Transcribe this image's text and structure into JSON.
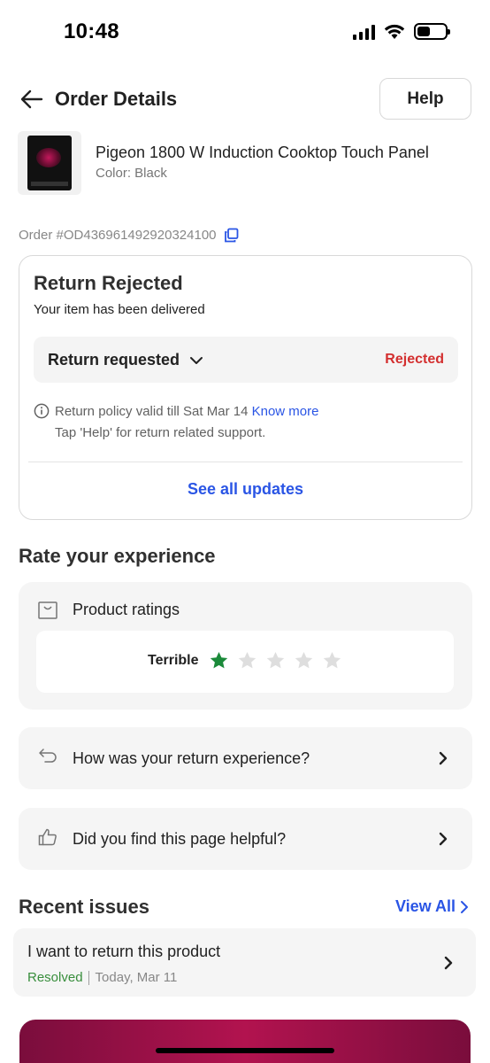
{
  "status_bar": {
    "time": "10:48"
  },
  "header": {
    "title": "Order Details",
    "help_label": "Help"
  },
  "product": {
    "name": "Pigeon 1800 W Induction Cooktop Touch Panel",
    "color": "Color: Black"
  },
  "order": {
    "id": "Order #OD436961492920324100"
  },
  "status_card": {
    "title": "Return Rejected",
    "subtitle": "Your item has been delivered",
    "return_label": "Return requested",
    "return_status": "Rejected",
    "policy_text": "Return policy valid till Sat Mar 14",
    "know_more": "Know more",
    "help_note": "Tap 'Help' for return related support.",
    "see_updates": "See all updates"
  },
  "rate": {
    "title": "Rate your experience",
    "product_ratings_label": "Product ratings",
    "rating_word": "Terrible",
    "rating_value": 1,
    "rating_max": 5,
    "return_experience_label": "How was your return experience?",
    "helpful_label": "Did you find this page helpful?"
  },
  "recent_issues": {
    "title": "Recent issues",
    "view_all": "View All",
    "items": [
      {
        "title": "I want to return this product",
        "status": "Resolved",
        "date": "Today, Mar 11"
      }
    ]
  },
  "colors": {
    "accent": "#2a55e5",
    "rejected": "#d32f2f",
    "resolved": "#388e3c",
    "star_filled": "#1b8a3a",
    "star_empty": "#dedede"
  }
}
